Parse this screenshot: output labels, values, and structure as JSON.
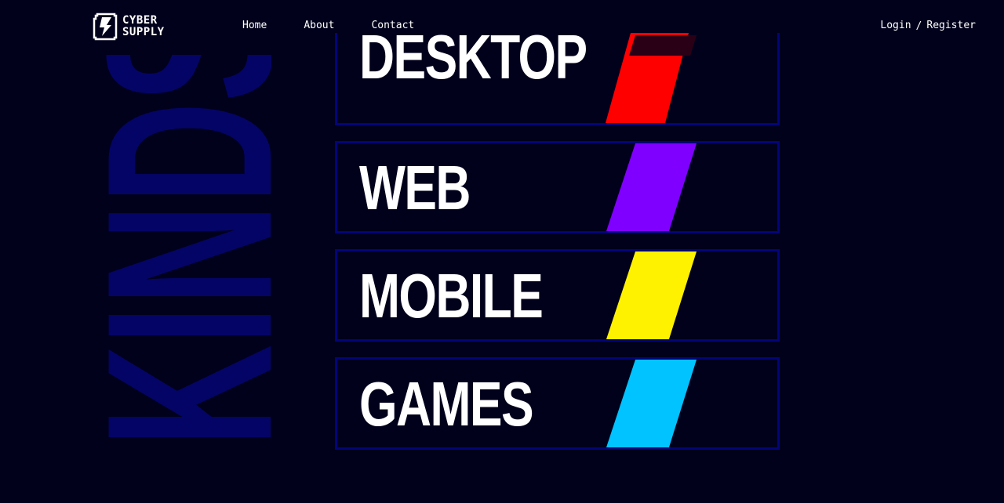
{
  "brand": {
    "name_line1": "CYBER",
    "name_line2": "SUPPLY"
  },
  "nav": {
    "items": [
      {
        "label": "Home"
      },
      {
        "label": "About"
      },
      {
        "label": "Contact"
      }
    ]
  },
  "auth": {
    "login_label": "Login",
    "separator": "/",
    "register_label": "Register"
  },
  "background_word": "KINDS",
  "categories": [
    {
      "label": "DESKTOP",
      "color": "#ff0000"
    },
    {
      "label": "WEB",
      "color": "#8000ff"
    },
    {
      "label": "MOBILE",
      "color": "#fff200"
    },
    {
      "label": "GAMES",
      "color": "#00c3ff"
    }
  ],
  "colors": {
    "background": "#01011c",
    "card_border": "#04047a",
    "background_word": "#040466",
    "text": "#ffffff"
  },
  "icons": {
    "logo": "lightning-bolt-logo-icon"
  }
}
